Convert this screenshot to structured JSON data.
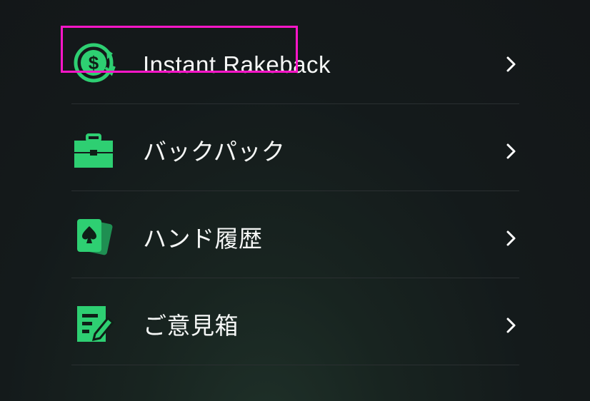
{
  "menu": {
    "items": [
      {
        "label": "Instant Rakeback",
        "icon": "dollar-refresh-icon",
        "highlighted": true
      },
      {
        "label": "バックパック",
        "icon": "briefcase-icon",
        "highlighted": false
      },
      {
        "label": "ハンド履歴",
        "icon": "spade-cards-icon",
        "highlighted": false
      },
      {
        "label": "ご意見箱",
        "icon": "feedback-edit-icon",
        "highlighted": false
      }
    ]
  },
  "colors": {
    "accent": "#2ecf72",
    "highlight_border": "#ff16c8",
    "text": "#f5f7f6",
    "divider": "#2a2f31"
  }
}
